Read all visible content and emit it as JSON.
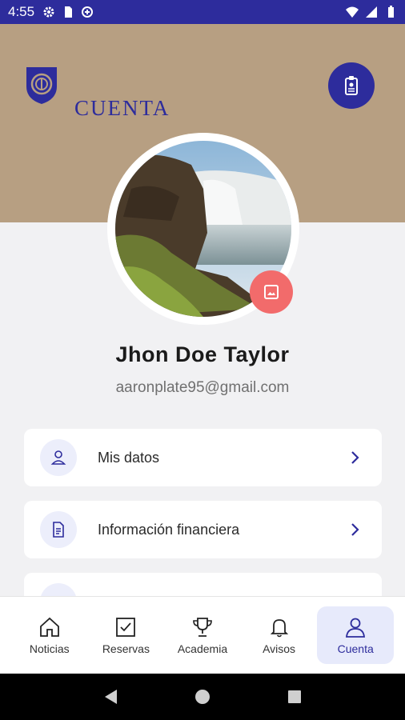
{
  "status_bar": {
    "time": "4:55",
    "left_icons": [
      "settings-icon",
      "sim-card-icon",
      "data-saver-icon"
    ],
    "right_icons": [
      "wifi-icon",
      "signal-icon",
      "battery-icon"
    ]
  },
  "header": {
    "title": "CUENTA",
    "logo": "club-logo",
    "action_icon": "id-badge-icon",
    "background": "#b79f82",
    "accent": "#2d2c9c"
  },
  "profile": {
    "name": "Jhon Doe Taylor",
    "email": "aaronplate95@gmail.com",
    "photo_icon": "image-icon",
    "photo_button_color": "#f26b6b"
  },
  "menu": {
    "items": [
      {
        "label": "Mis datos",
        "icon": "user-icon"
      },
      {
        "label": "Información financiera",
        "icon": "document-icon"
      },
      {
        "label": "",
        "icon": "partial-icon"
      }
    ]
  },
  "bottom_nav": {
    "items": [
      {
        "label": "Noticias",
        "icon": "home-icon",
        "active": false
      },
      {
        "label": "Reservas",
        "icon": "checkbox-icon",
        "active": false
      },
      {
        "label": "Academia",
        "icon": "trophy-icon",
        "active": false
      },
      {
        "label": "Avisos",
        "icon": "bell-icon",
        "active": false
      },
      {
        "label": "Cuenta",
        "icon": "user-icon",
        "active": true
      }
    ]
  },
  "system_nav": [
    "back-icon",
    "home-circle-icon",
    "recents-icon"
  ]
}
